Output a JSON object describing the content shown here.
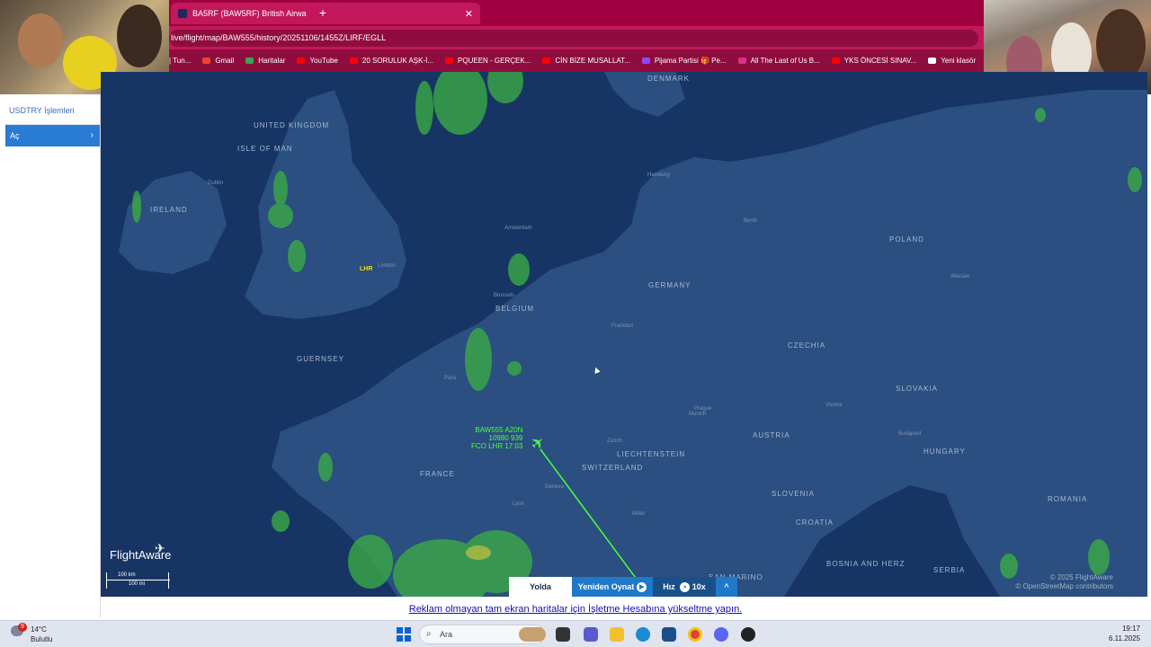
{
  "browser": {
    "tab_title": "BA5RF (BAW5RF) British Airwa",
    "tab_close": "✕",
    "new_tab": "+",
    "url": "live/flight/map/BAW555/history/20251106/1455Z/LIRF/EGLL",
    "bookmarks": [
      {
        "label": "| Tun...",
        "color": ""
      },
      {
        "label": "Gmail",
        "color": "#ea4335"
      },
      {
        "label": "Haritalar",
        "color": "#34a853"
      },
      {
        "label": "YouTube",
        "color": "#ff0000"
      },
      {
        "label": "20 SORULUK AŞK-İ...",
        "color": "#ff0000"
      },
      {
        "label": "PQUEEN - GERÇEK...",
        "color": "#ff0000"
      },
      {
        "label": "CİN BİZE MUSALLAT...",
        "color": "#ff0000"
      },
      {
        "label": "Pijama Partisi 🎁 Pe...",
        "color": "#9146ff"
      },
      {
        "label": "All The Last of Us B...",
        "color": "#d63384"
      },
      {
        "label": "YKS ÖNCESİ SINAV...",
        "color": "#ff0000"
      },
      {
        "label": "Yeni klasör",
        "color": "#ffffff"
      }
    ]
  },
  "leftpanel": {
    "title": "USDTRY İşlemleri",
    "button": "Aç",
    "chevron": "›"
  },
  "map": {
    "countries": [
      "DENMARK",
      "UNITED KINGDOM",
      "ISLE OF MAN",
      "IRELAND",
      "GUERNSEY",
      "BELGIUM",
      "GERMANY",
      "POLAND",
      "CZECHIA",
      "SLOVAKIA",
      "AUSTRIA",
      "LIECHTENSTEIN",
      "SWITZERLAND",
      "HUNGARY",
      "FRANCE",
      "SLOVENIA",
      "CROATIA",
      "ROMANIA",
      "BOSNIA AND HERZ",
      "SERBIA",
      "SAN MARINO"
    ],
    "cities": [
      "Dublin",
      "London",
      "Amsterdam",
      "Brussels",
      "Hamburg",
      "Berlin",
      "Frankfurt",
      "Paris",
      "Munich",
      "Vienna",
      "Prague",
      "Budapest",
      "Zurich",
      "Lyon",
      "Geneva",
      "Milan",
      "Warsaw"
    ],
    "airport": "LHR",
    "flight_label": [
      "BAW555 A20N",
      "10980 939",
      "FCO LHR 17:03"
    ],
    "logo": "FlightAware",
    "scale_km": "100 km",
    "scale_mi": "100 mi",
    "copyright_1": "© 2025 FlightAware",
    "copyright_2": "© OpenStreetMap contributors"
  },
  "controls": {
    "status": "Yolda",
    "replay": "Yeniden Oynat",
    "speed_label": "Hız",
    "speed_value": "10x",
    "expand": "^"
  },
  "ad_link": "Reklam olmayan tam ekran haritalar için İşletme Hesabına yükseltme yapın.",
  "taskbar": {
    "weather_temp": "14°C",
    "weather_desc": "Bulutlu",
    "weather_badge": "9",
    "search_placeholder": "Ara",
    "time": "19:17",
    "date": "6.11.2025"
  },
  "colors": {
    "tabbar": "#a0003f",
    "map_land": "#2a4f80",
    "map_sea": "#173564",
    "radar": "#3cb043",
    "flight_track": "#4cff3a"
  }
}
